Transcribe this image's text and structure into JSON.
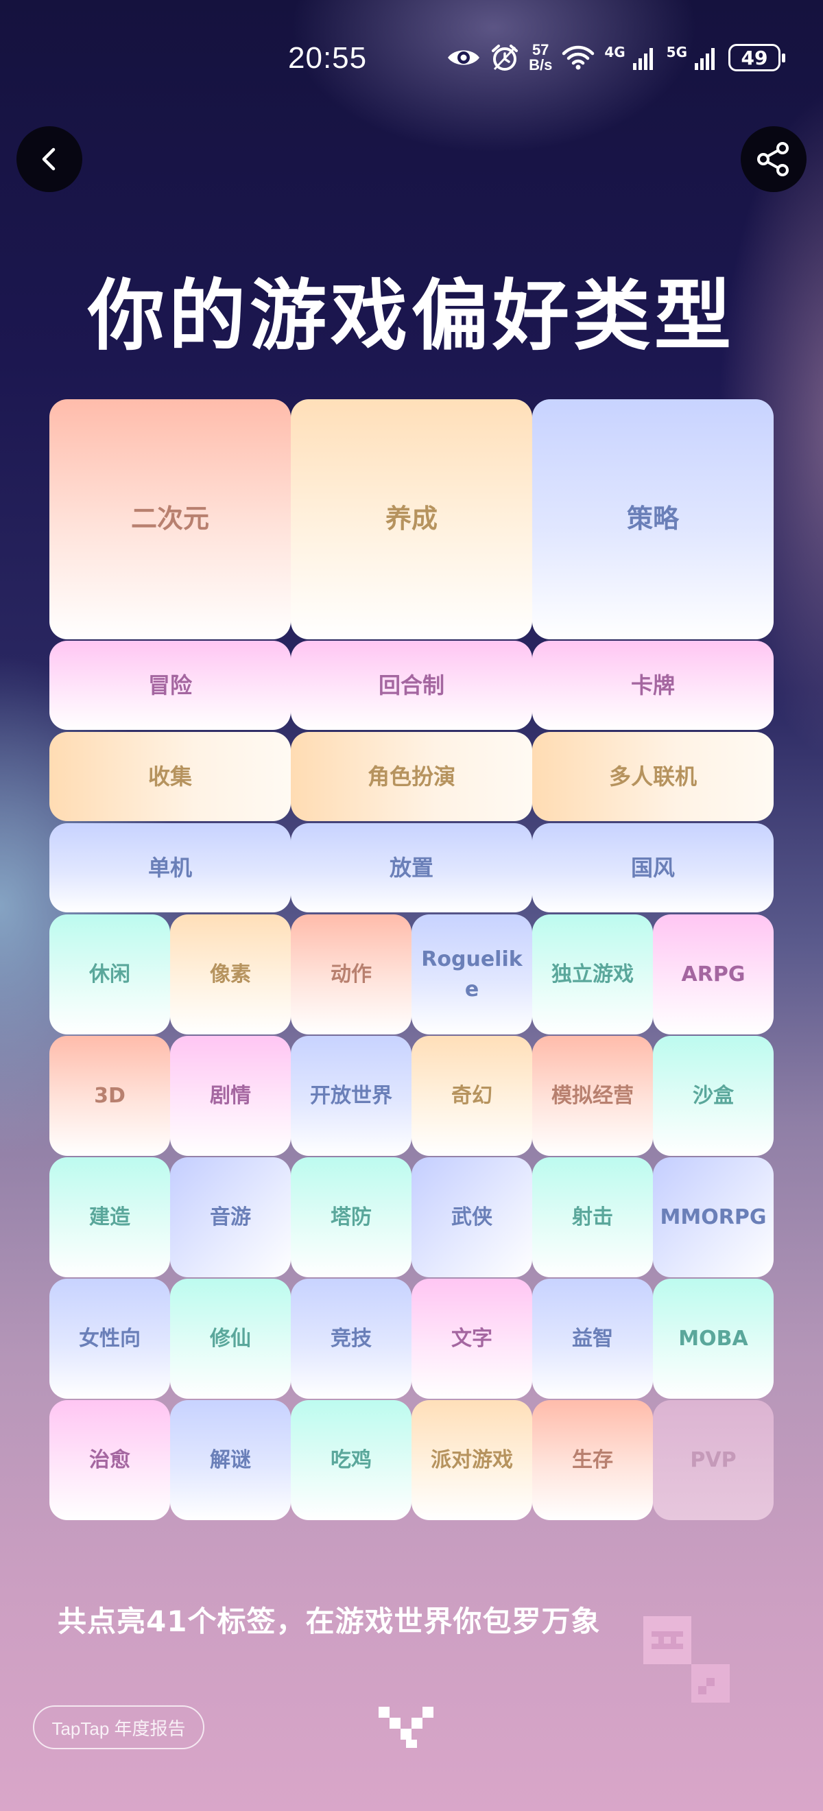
{
  "status_bar": {
    "time": "20:55",
    "net_speed_value": "57",
    "net_speed_unit": "B/s",
    "signal_1_label": "4G",
    "signal_2_label": "5G",
    "battery": "49",
    "icons": [
      "eye-icon",
      "alarm-icon",
      "wifi-icon",
      "signal-icon",
      "signal-icon",
      "battery-icon"
    ]
  },
  "header": {
    "back_icon": "chevron-left-icon",
    "share_icon": "share-icon"
  },
  "title": "你的游戏偏好类型",
  "tags": {
    "big": [
      "二次元",
      "养成",
      "策略"
    ],
    "wide": [
      [
        "冒险",
        "回合制",
        "卡牌"
      ],
      [
        "收集",
        "角色扮演",
        "多人联机"
      ],
      [
        "单机",
        "放置",
        "国风"
      ]
    ],
    "small": [
      [
        "休闲",
        "像素",
        "动作",
        "Roguelike",
        "独立游戏",
        "ARPG"
      ],
      [
        "3D",
        "剧情",
        "开放世界",
        "奇幻",
        "模拟经营",
        "沙盒"
      ],
      [
        "建造",
        "音游",
        "塔防",
        "武侠",
        "射击",
        "MMORPG"
      ],
      [
        "女性向",
        "修仙",
        "竞技",
        "文字",
        "益智",
        "MOBA"
      ],
      [
        "治愈",
        "解谜",
        "吃鸡",
        "派对游戏",
        "生存",
        "PVP"
      ]
    ],
    "lit_count": 41,
    "dim_tags": [
      "PVP"
    ]
  },
  "summary": "共点亮41个标签，在游戏世界你包罗万象",
  "footer": {
    "badge": "TapTap 年度报告"
  },
  "colors": {
    "peach": "#ffbcab",
    "cream": "#ffdfb9",
    "blue": "#c8d3ff",
    "pink": "#ffc6f3",
    "mint": "#bdfbef"
  }
}
